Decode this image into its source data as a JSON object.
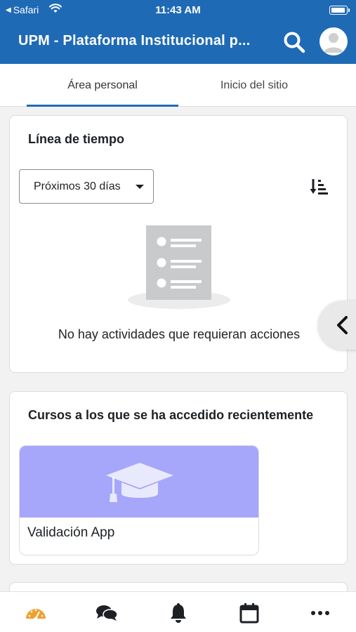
{
  "status_bar": {
    "back_app": "Safari",
    "time": "11:43 AM"
  },
  "header": {
    "title": "UPM - Plataforma Institucional p...",
    "icons": [
      "search-icon",
      "user-avatar-icon"
    ]
  },
  "tabs": [
    {
      "label": "Área personal",
      "active": true
    },
    {
      "label": "Inicio del sitio",
      "active": false
    }
  ],
  "timeline": {
    "title": "Línea de tiempo",
    "filter": {
      "selected": "Próximos 30 días"
    },
    "sort_icon": "sort-descending-icon",
    "empty_message": "No hay actividades que requieran acciones"
  },
  "recent_courses": {
    "title": "Cursos a los que se ha accedido recientemente",
    "courses": [
      {
        "name": "Validación App",
        "image_color": "#a6a6fb",
        "icon": "graduation-cap-icon"
      }
    ]
  },
  "bottom_nav": [
    {
      "icon": "dashboard-icon",
      "active": true,
      "color": "#f0a030"
    },
    {
      "icon": "messages-icon",
      "active": false
    },
    {
      "icon": "notifications-icon",
      "active": false
    },
    {
      "icon": "calendar-icon",
      "active": false
    },
    {
      "icon": "more-icon",
      "active": false
    }
  ],
  "colors": {
    "header_bg": "#1f6ab5",
    "active_tab_underline": "#1f6ab5",
    "page_bg": "#f2f2f3"
  }
}
